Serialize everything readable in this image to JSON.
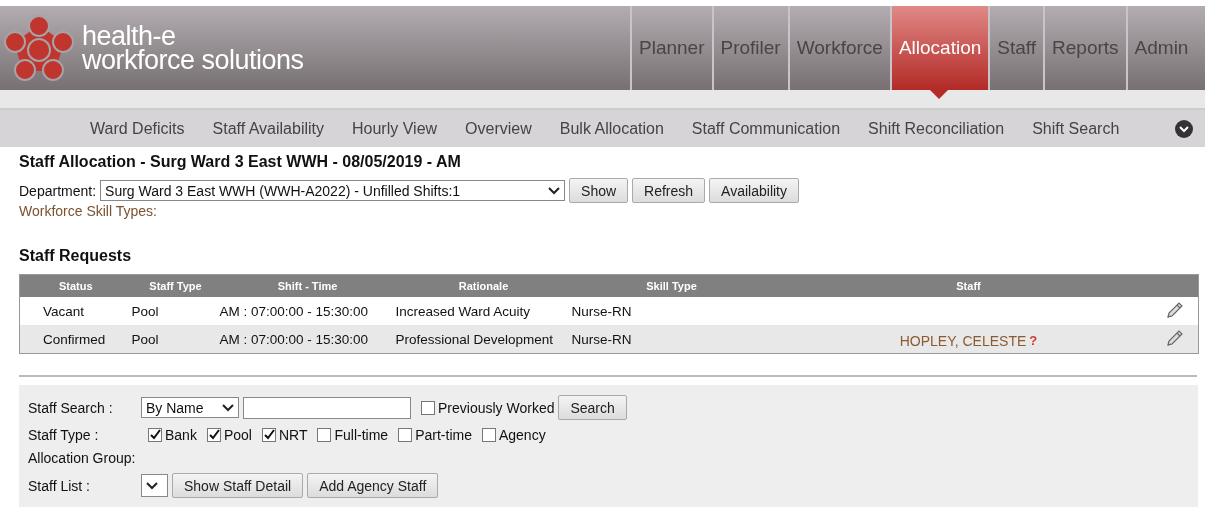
{
  "header": {
    "logo_line_1": "health-e",
    "logo_line_2": "workforce solutions",
    "tabs": [
      {
        "label": "Planner",
        "selected": false
      },
      {
        "label": "Profiler",
        "selected": false
      },
      {
        "label": "Workforce",
        "selected": false
      },
      {
        "label": "Allocation",
        "selected": true
      },
      {
        "label": "Staff",
        "selected": false
      },
      {
        "label": "Reports",
        "selected": false
      },
      {
        "label": "Admin",
        "selected": false
      }
    ]
  },
  "subnav": [
    "Ward Deficits",
    "Staff Availability",
    "Hourly View",
    "Overview",
    "Bulk Allocation",
    "Staff Communication",
    "Shift Reconciliation",
    "Shift Search"
  ],
  "title": "Staff Allocation - Surg Ward 3 East WWH - 08/05/2019 - AM",
  "department": {
    "label": "Department:",
    "value": "Surg Ward 3 East WWH (WWH-A2022) - Unfilled Shifts:1",
    "buttons": [
      "Show",
      "Refresh",
      "Availability"
    ]
  },
  "skill_types_label": "Workforce Skill Types:",
  "requests": {
    "title": "Staff Requests",
    "columns": [
      "Status",
      "Staff Type",
      "Shift - Time",
      "Rationale",
      "Skill Type",
      "Staff"
    ],
    "rows": [
      {
        "status": "Vacant",
        "staff_type": "Pool",
        "shift_time": "AM : 07:00:00 - 15:30:00",
        "rationale": "Increased Ward Acuity",
        "skill_type": "Nurse-RN"
      },
      {
        "status": "Confirmed",
        "staff_type": "Pool",
        "shift_time": "AM : 07:00:00 - 15:30:00",
        "rationale": "Professional Development",
        "skill_type": "Nurse-RN",
        "staff": "HOPLEY, CELESTE",
        "staff_flag": "?"
      }
    ]
  },
  "search": {
    "staff_search_label": "Staff Search :",
    "search_by": "By Name",
    "previously_worked": {
      "label": "Previously Worked",
      "checked": false
    },
    "search_button": "Search",
    "staff_type_label": "Staff Type :",
    "staff_types": [
      {
        "label": "Bank",
        "checked": true
      },
      {
        "label": "Pool",
        "checked": true
      },
      {
        "label": "NRT",
        "checked": true
      },
      {
        "label": "Full-time",
        "checked": false
      },
      {
        "label": "Part-time",
        "checked": false
      },
      {
        "label": "Agency",
        "checked": false
      }
    ],
    "allocation_group_label": "Allocation Group:",
    "staff_list_label": "Staff List :",
    "buttons": [
      "Show Staff Detail",
      "Add Agency Staff"
    ]
  }
}
